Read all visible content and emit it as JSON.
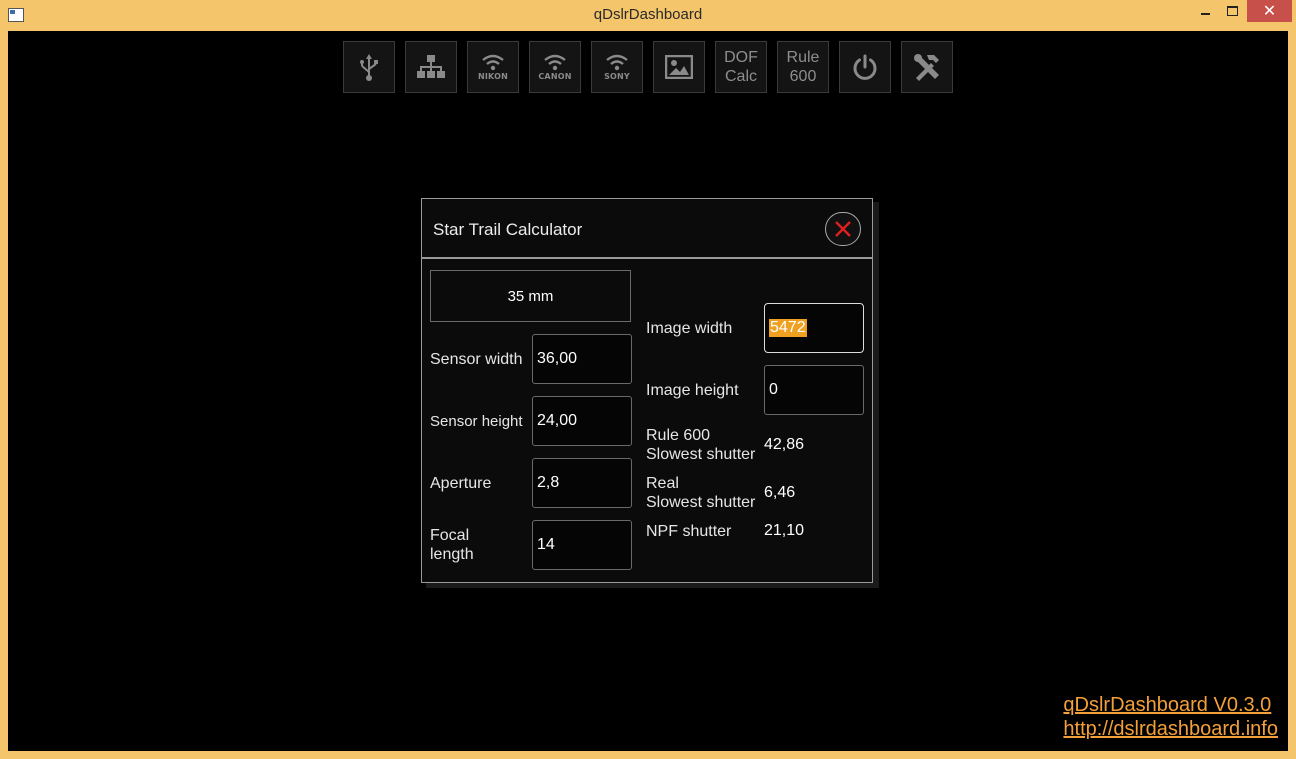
{
  "window": {
    "title": "qDslrDashboard",
    "close_glyph": "✕"
  },
  "toolbar": {
    "buttons": [
      {
        "name": "usb",
        "icon": "usb-icon"
      },
      {
        "name": "network",
        "icon": "network-icon"
      },
      {
        "name": "nikon-wifi",
        "icon": "wifi-icon",
        "brand": "NIKON"
      },
      {
        "name": "canon-wifi",
        "icon": "wifi-icon",
        "brand": "CANON"
      },
      {
        "name": "sony-wifi",
        "icon": "wifi-icon",
        "brand": "SONY"
      },
      {
        "name": "image-viewer",
        "icon": "image-icon"
      },
      {
        "name": "dof-calc",
        "line1": "DOF",
        "line2": "Calc"
      },
      {
        "name": "rule-600",
        "line1": "Rule",
        "line2": "600"
      },
      {
        "name": "power",
        "icon": "power-icon"
      },
      {
        "name": "settings",
        "icon": "tools-icon"
      }
    ]
  },
  "dialog": {
    "title": "Star Trail Calculator",
    "lens_preset": "35 mm",
    "sensor_width_label": "Sensor width",
    "sensor_width_value": "36,00",
    "sensor_height_label": "Sensor height",
    "sensor_height_value": "24,00",
    "aperture_label": "Aperture",
    "aperture_value": "2,8",
    "focal_length_label_1": "Focal",
    "focal_length_label_2": "length",
    "focal_length_value": "14",
    "image_width_label": "Image width",
    "image_width_value": "5472",
    "image_height_label": "Image height",
    "image_height_value": "0",
    "rule600_label_1": "Rule 600",
    "rule600_label_2": "Slowest shutter",
    "rule600_value": "42,86",
    "real_label_1": "Real",
    "real_label_2": "Slowest shutter",
    "real_value": "6,46",
    "npf_label": "NPF shutter",
    "npf_value": "21,10"
  },
  "footer": {
    "version": "qDslrDashboard V0.3.0",
    "url": "http://dslrdashboard.info"
  },
  "colors": {
    "frame": "#f4c56a",
    "background": "#000000",
    "accent": "#f3a03a",
    "close_red": "#e02020",
    "selection": "#f0a020"
  }
}
